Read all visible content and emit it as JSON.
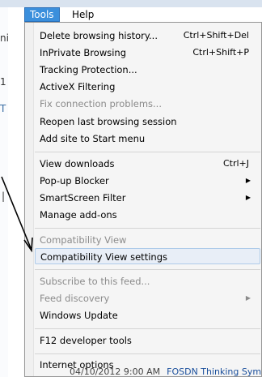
{
  "menubar": {
    "tools_label": "Tools",
    "help_label": "Help"
  },
  "background": {
    "frag_1": "ni",
    "frag_2": "1",
    "frag_3": "T",
    "frag_4": "|",
    "bottom_date": "04/10/2012 9:00 AM",
    "bottom_link": "FOSDN Thinking Symp"
  },
  "tools_menu": {
    "delete_history": {
      "label": "Delete browsing history...",
      "shortcut": "Ctrl+Shift+Del"
    },
    "inprivate": {
      "label": "InPrivate Browsing",
      "shortcut": "Ctrl+Shift+P"
    },
    "tracking_protection": {
      "label": "Tracking Protection..."
    },
    "activex_filtering": {
      "label": "ActiveX Filtering"
    },
    "fix_connection": {
      "label": "Fix connection problems..."
    },
    "reopen_session": {
      "label": "Reopen last browsing session"
    },
    "add_to_start": {
      "label": "Add site to Start menu"
    },
    "view_downloads": {
      "label": "View downloads",
      "shortcut": "Ctrl+J"
    },
    "popup_blocker": {
      "label": "Pop-up Blocker"
    },
    "smartscreen": {
      "label": "SmartScreen Filter"
    },
    "manage_addons": {
      "label": "Manage add-ons"
    },
    "compat_view": {
      "label": "Compatibility View"
    },
    "compat_view_settings": {
      "label": "Compatibility View settings"
    },
    "subscribe_feed": {
      "label": "Subscribe to this feed..."
    },
    "feed_discovery": {
      "label": "Feed discovery"
    },
    "windows_update": {
      "label": "Windows Update"
    },
    "f12_tools": {
      "label": "F12 developer tools"
    },
    "internet_options": {
      "label": "Internet options"
    }
  },
  "colors": {
    "tools_highlight": "#3b8fdc",
    "selected_item_bg": "#e8eef7",
    "selected_item_border": "#aecbe9",
    "disabled_text": "#8b8b8b"
  }
}
